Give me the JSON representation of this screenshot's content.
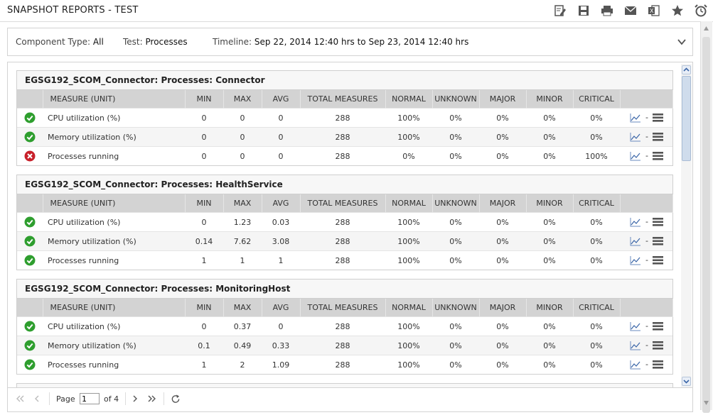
{
  "app": {
    "title": "SNAPSHOT REPORTS - TEST"
  },
  "toolbar": [
    "edit-report-icon",
    "save-icon",
    "print-icon",
    "email-icon",
    "excel-export-icon",
    "favorite-star-icon",
    "schedule-alarm-icon"
  ],
  "filters": {
    "component_type_label": "Component Type:",
    "component_type_value": "All",
    "test_label": "Test:",
    "test_value": "Processes",
    "timeline_label": "Timeline:",
    "timeline_value": "Sep 22, 2014 12:40 hrs to Sep 23, 2014 12:40 hrs"
  },
  "columns": [
    "MEASURE (UNIT)",
    "MIN",
    "MAX",
    "AVG",
    "TOTAL MEASURES",
    "NORMAL",
    "UNKNOWN",
    "MAJOR",
    "MINOR",
    "CRITICAL"
  ],
  "action_dash": "-",
  "panels": [
    {
      "title": "EGSG192_SCOM_Connector: Processes: Connector",
      "rows": [
        {
          "status": "ok",
          "measure": "CPU utilization (%)",
          "min": "0",
          "max": "0",
          "avg": "0",
          "total": "288",
          "normal": "100%",
          "unknown": "0%",
          "major": "0%",
          "minor": "0%",
          "critical": "0%"
        },
        {
          "status": "ok",
          "measure": "Memory utilization (%)",
          "min": "0",
          "max": "0",
          "avg": "0",
          "total": "288",
          "normal": "100%",
          "unknown": "0%",
          "major": "0%",
          "minor": "0%",
          "critical": "0%"
        },
        {
          "status": "error",
          "measure": "Processes running",
          "min": "0",
          "max": "0",
          "avg": "0",
          "total": "288",
          "normal": "0%",
          "unknown": "0%",
          "major": "0%",
          "minor": "0%",
          "critical": "100%"
        }
      ]
    },
    {
      "title": "EGSG192_SCOM_Connector: Processes: HealthService",
      "rows": [
        {
          "status": "ok",
          "measure": "CPU utilization (%)",
          "min": "0",
          "max": "1.23",
          "avg": "0.03",
          "total": "288",
          "normal": "100%",
          "unknown": "0%",
          "major": "0%",
          "minor": "0%",
          "critical": "0%"
        },
        {
          "status": "ok",
          "measure": "Memory utilization (%)",
          "min": "0.14",
          "max": "7.62",
          "avg": "3.08",
          "total": "288",
          "normal": "100%",
          "unknown": "0%",
          "major": "0%",
          "minor": "0%",
          "critical": "0%"
        },
        {
          "status": "ok",
          "measure": "Processes running",
          "min": "1",
          "max": "1",
          "avg": "1",
          "total": "288",
          "normal": "100%",
          "unknown": "0%",
          "major": "0%",
          "minor": "0%",
          "critical": "0%"
        }
      ]
    },
    {
      "title": "EGSG192_SCOM_Connector: Processes: MonitoringHost",
      "rows": [
        {
          "status": "ok",
          "measure": "CPU utilization (%)",
          "min": "0",
          "max": "0.37",
          "avg": "0",
          "total": "288",
          "normal": "100%",
          "unknown": "0%",
          "major": "0%",
          "minor": "0%",
          "critical": "0%"
        },
        {
          "status": "ok",
          "measure": "Memory utilization (%)",
          "min": "0.1",
          "max": "0.49",
          "avg": "0.33",
          "total": "288",
          "normal": "100%",
          "unknown": "0%",
          "major": "0%",
          "minor": "0%",
          "critical": "0%"
        },
        {
          "status": "ok",
          "measure": "Processes running",
          "min": "1",
          "max": "2",
          "avg": "1.09",
          "total": "288",
          "normal": "100%",
          "unknown": "0%",
          "major": "0%",
          "minor": "0%",
          "critical": "0%"
        }
      ]
    }
  ],
  "pagination": {
    "page_label": "Page",
    "current_page": "1",
    "of_label": "of 4"
  },
  "colors": {
    "ok": "#2e9e2e",
    "error": "#c8202a",
    "header_bg": "#d3d3d3",
    "accent": "#3b66a8"
  }
}
